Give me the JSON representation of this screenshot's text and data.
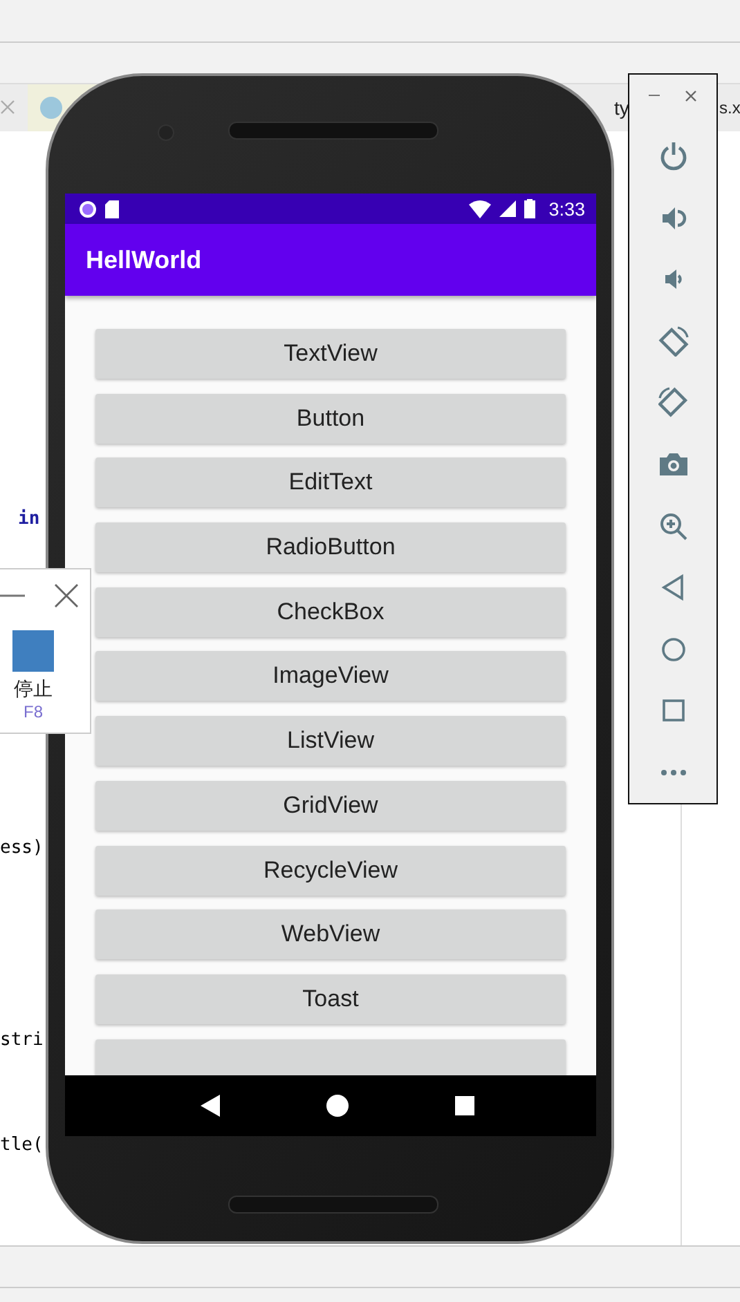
{
  "ide": {
    "tabs": [
      {
        "label": "ty"
      },
      {
        "label": "s.x"
      }
    ],
    "code_lines": [
      {
        "text": "in",
        "kind": "keyword"
      },
      {
        "text": "ess)",
        "kind": "plain"
      },
      {
        "text": "stri",
        "kind": "plain"
      },
      {
        "text": "tle(",
        "kind": "plain"
      }
    ]
  },
  "stop_panel": {
    "label": "停止",
    "shortcut": "F8"
  },
  "phone": {
    "status_bar": {
      "time": "3:33"
    },
    "app_bar": {
      "title": "HellWorld"
    },
    "buttons": [
      "TextView",
      "Button",
      "EditText",
      "RadioButton",
      "CheckBox",
      "ImageView",
      "ListView",
      "GridView",
      "RecycleView",
      "WebView",
      "Toast"
    ]
  }
}
